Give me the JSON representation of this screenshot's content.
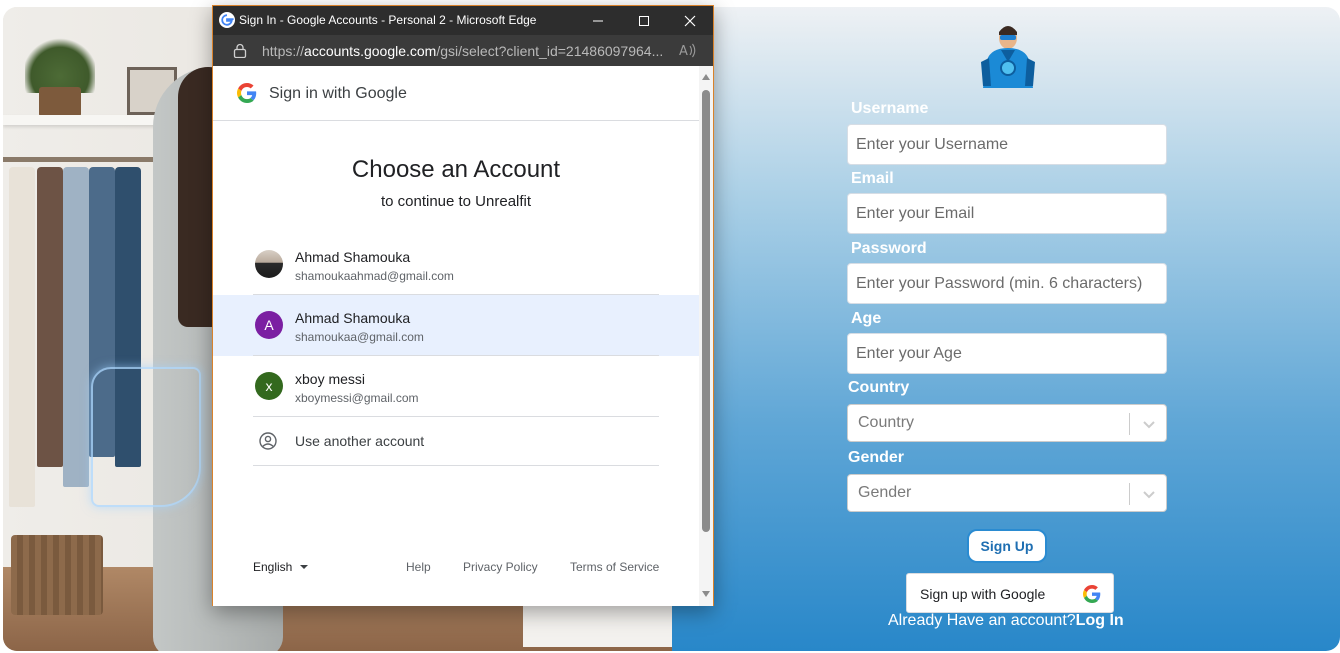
{
  "popup": {
    "window_title": "Sign In - Google Accounts - Personal 2 - Microsoft Edge",
    "url_prefix": "https://",
    "url_host": "accounts.google.com",
    "url_rest": "/gsi/select?client_id=21486097964...",
    "header_title": "Sign in with Google",
    "heading": "Choose an Account",
    "subheading": "to continue to Unrealfit",
    "accounts": [
      {
        "name": "Ahmad Shamouka",
        "email": "shamoukaahmad@gmail.com",
        "avatar": "photo"
      },
      {
        "name": "Ahmad Shamouka",
        "email": "shamoukaa@gmail.com",
        "avatar_letter": "A",
        "avatar_color": "#7b1fa2"
      },
      {
        "name": "xboy messi",
        "email": "xboymessi@gmail.com",
        "avatar_letter": "x",
        "avatar_color": "#33691e"
      }
    ],
    "use_another": "Use another account",
    "footer": {
      "language": "English",
      "help": "Help",
      "privacy": "Privacy Policy",
      "terms": "Terms of Service"
    }
  },
  "signup": {
    "username_label": "Username",
    "username_placeholder": "Enter your Username",
    "email_label": "Email",
    "email_placeholder": "Enter your Email",
    "password_label": "Password",
    "password_placeholder": "Enter your Password (min. 6 characters)",
    "age_label": "Age",
    "age_placeholder": "Enter your Age",
    "country_label": "Country",
    "country_value": "Country",
    "gender_label": "Gender",
    "gender_value": "Gender",
    "signup_button": "Sign Up",
    "google_button": "Sign up with Google",
    "have_account": "Already Have an account?",
    "login_link": "Log In"
  },
  "colors": {
    "accent": "#2a8bd1",
    "popup_border": "#d9822b",
    "selected_row": "#e8f0fe"
  }
}
